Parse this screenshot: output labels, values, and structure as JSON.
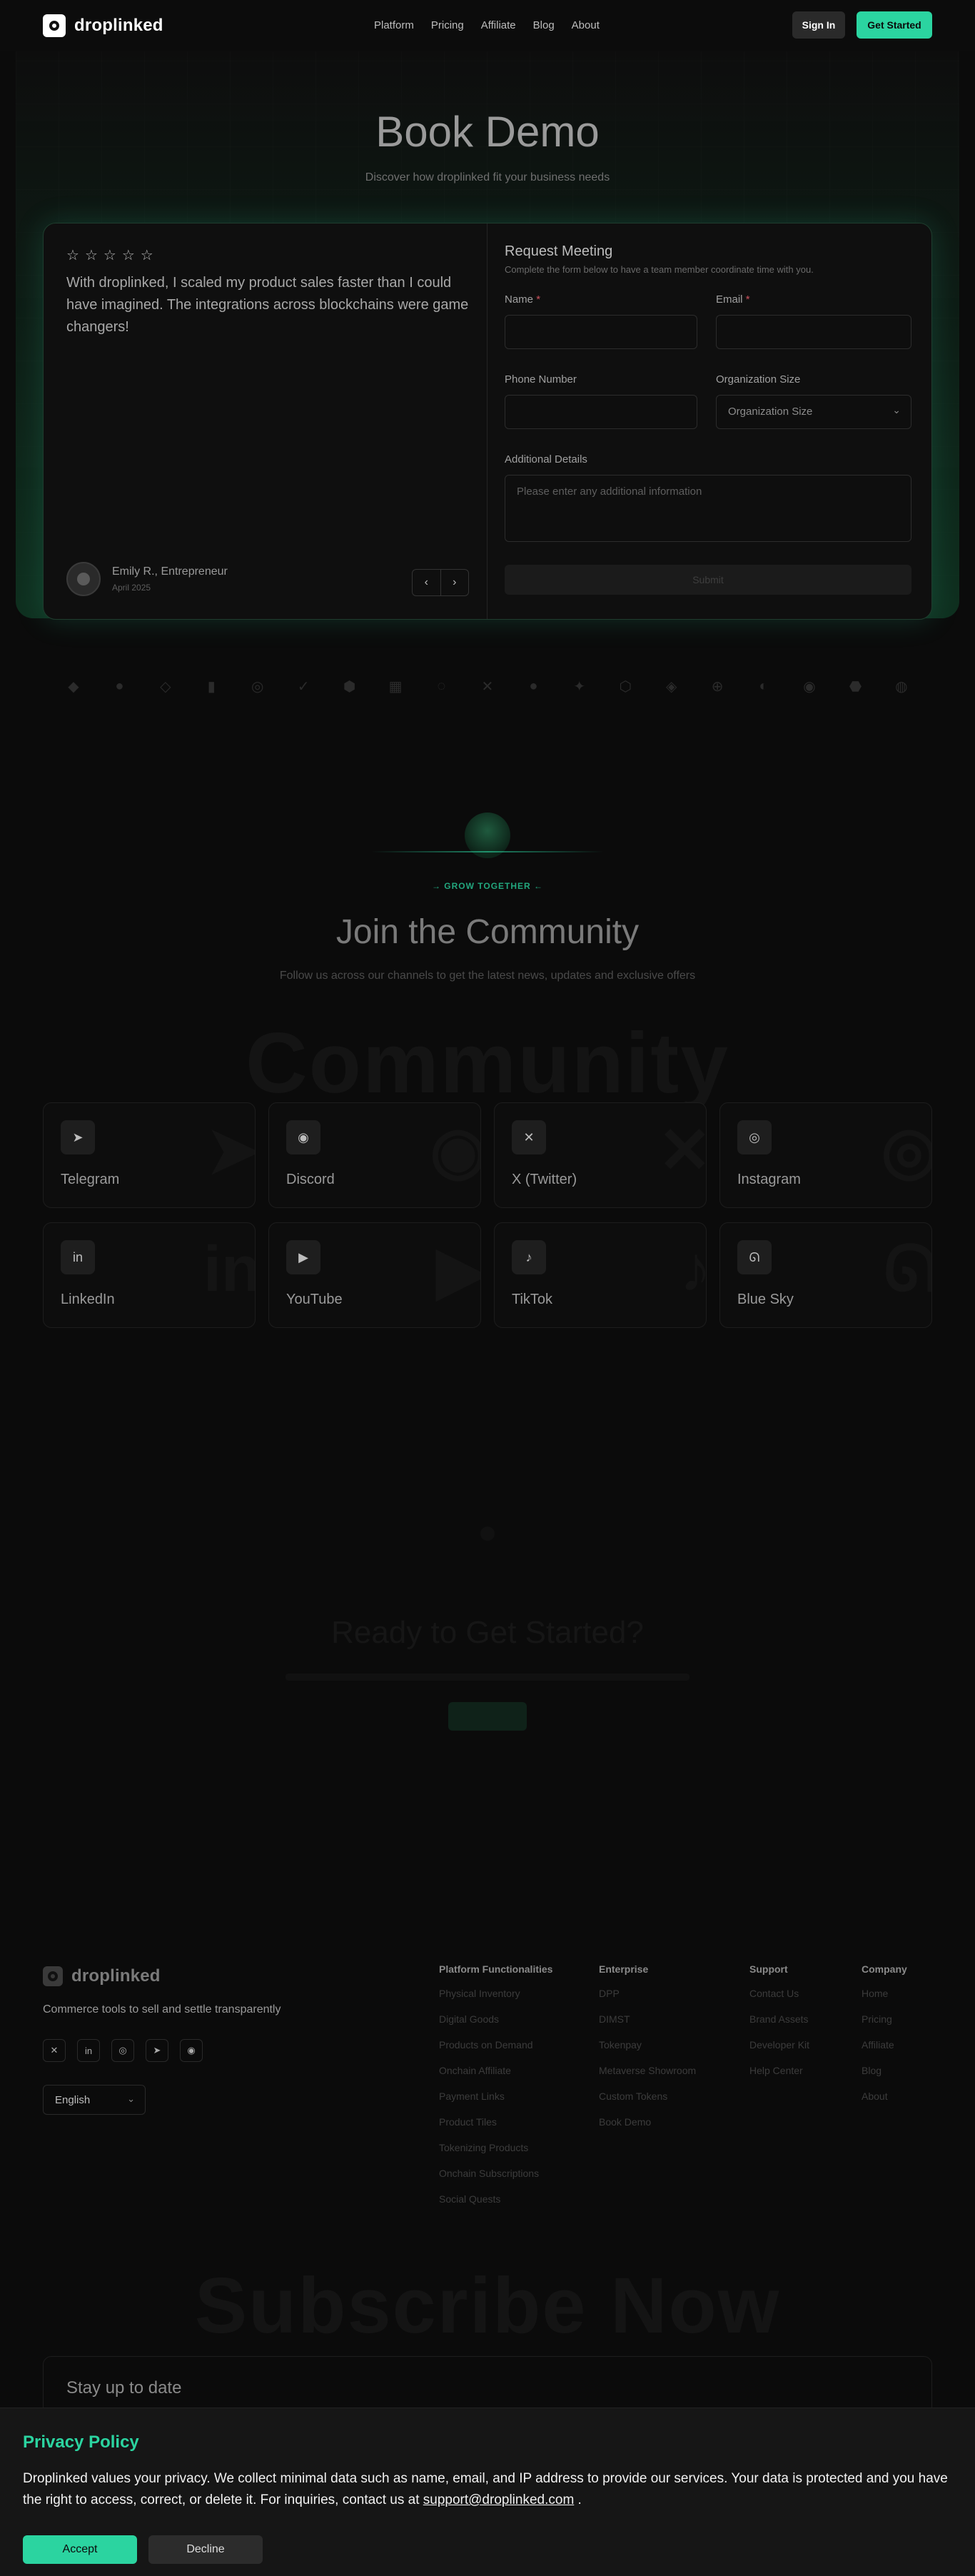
{
  "header": {
    "brand": "droplinked",
    "nav": [
      "Platform",
      "Pricing",
      "Affiliate",
      "Blog",
      "About"
    ],
    "sign_in": "Sign In",
    "get_started": "Get Started"
  },
  "hero": {
    "title": "Book Demo",
    "subtitle": "Discover how droplinked fit your business needs"
  },
  "testimonial": {
    "rating": 0,
    "quote": "With droplinked, I scaled my product sales faster than I could have imagined. The integrations across blockchains were game changers!",
    "name": "Emily R., Entrepreneur",
    "date": "April 2025"
  },
  "form": {
    "title": "Request Meeting",
    "subtitle": "Complete the form below to have a team member coordinate time with you.",
    "name_label": "Name",
    "email_label": "Email",
    "required_mark": "*",
    "phone_label": "Phone Number",
    "org_label": "Organization Size",
    "org_value": "Organization Size",
    "details_label": "Additional Details",
    "details_placeholder": "Please enter any additional information",
    "submit": "Submit"
  },
  "community": {
    "tag": "→ GROW TOGETHER ←",
    "title": "Join the Community",
    "subtitle": "Follow us across our channels to get the latest news, updates and exclusive offers",
    "watermark": "Community",
    "channels": [
      {
        "label": "Telegram",
        "icon": "telegram-icon"
      },
      {
        "label": "Discord",
        "icon": "discord-icon"
      },
      {
        "label": "X (Twitter)",
        "icon": "x-icon"
      },
      {
        "label": "Instagram",
        "icon": "instagram-icon"
      },
      {
        "label": "LinkedIn",
        "icon": "linkedin-icon"
      },
      {
        "label": "YouTube",
        "icon": "youtube-icon"
      },
      {
        "label": "TikTok",
        "icon": "tiktok-icon"
      },
      {
        "label": "Blue Sky",
        "icon": "bluesky-icon"
      }
    ]
  },
  "cta": {
    "title": "Ready to Get Started?"
  },
  "footer": {
    "brand": "droplinked",
    "tagline": "Commerce tools to sell and settle transparently",
    "language": "English",
    "columns": [
      {
        "title": "Platform Functionalities",
        "items": [
          "Physical Inventory",
          "Digital Goods",
          "Products on Demand",
          "Onchain Affiliate",
          "Payment Links",
          "Product Tiles",
          "Tokenizing Products",
          "Onchain Subscriptions",
          "Social Quests"
        ]
      },
      {
        "title": "Enterprise",
        "items": [
          "DPP",
          "DIMST",
          "Tokenpay",
          "Metaverse Showroom",
          "Custom Tokens",
          "Book Demo"
        ]
      },
      {
        "title": "Support",
        "items": [
          "Contact Us",
          "Brand Assets",
          "Developer Kit",
          "Help Center"
        ]
      },
      {
        "title": "Company",
        "items": [
          "Home",
          "Pricing",
          "Affiliate",
          "Blog",
          "About"
        ]
      }
    ]
  },
  "subscribe": {
    "watermark": "Subscribe Now",
    "title": "Stay up to date"
  },
  "cookie": {
    "title": "Privacy Policy",
    "text": "Droplinked values your privacy. We collect minimal data such as name, email, and IP address to provide our services. Your data is protected and you have the right to access, correct, or delete it. For inquiries, contact us at ",
    "email": "support@droplinked.com",
    "text_end": " .",
    "accept": "Accept",
    "decline": "Decline"
  },
  "colors": {
    "accent": "#2bd4a0",
    "background": "#0b0b0b",
    "required": "#c9515c"
  }
}
